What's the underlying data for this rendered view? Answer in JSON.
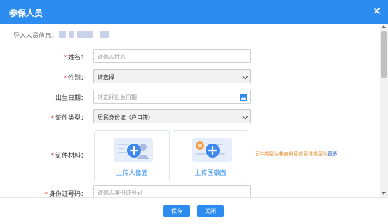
{
  "dialog": {
    "title": "参保人员",
    "close_glyph": "×"
  },
  "import_info": {
    "label": "导入人员信息："
  },
  "form": {
    "name": {
      "label": "姓名：",
      "required": true,
      "placeholder": "请输入姓名"
    },
    "gender": {
      "label": "性别：",
      "required": true,
      "value": "请选择"
    },
    "birth_date": {
      "label": "出生日期：",
      "required": false,
      "placeholder": "请选择出生日期",
      "icon": "calendar-icon"
    },
    "id_type": {
      "label": "证件类型：",
      "required": true,
      "value": "居民身份证（户口簿）"
    },
    "id_material": {
      "label": "证件材料：",
      "required": true,
      "upload_front_label": "上传人像面",
      "upload_back_label": "上传国徽面",
      "note": "证件类型为非身份证或证件类型为",
      "more_link": "更多"
    },
    "id_number": {
      "label": "身份证号码：",
      "required": true,
      "placeholder": "请输入身份证号码"
    }
  },
  "footer": {
    "save_label": "保存",
    "close_label": "关闭"
  },
  "colors": {
    "primary": "#2d8cf0",
    "required": "#e02020",
    "note": "#e98a2b"
  }
}
